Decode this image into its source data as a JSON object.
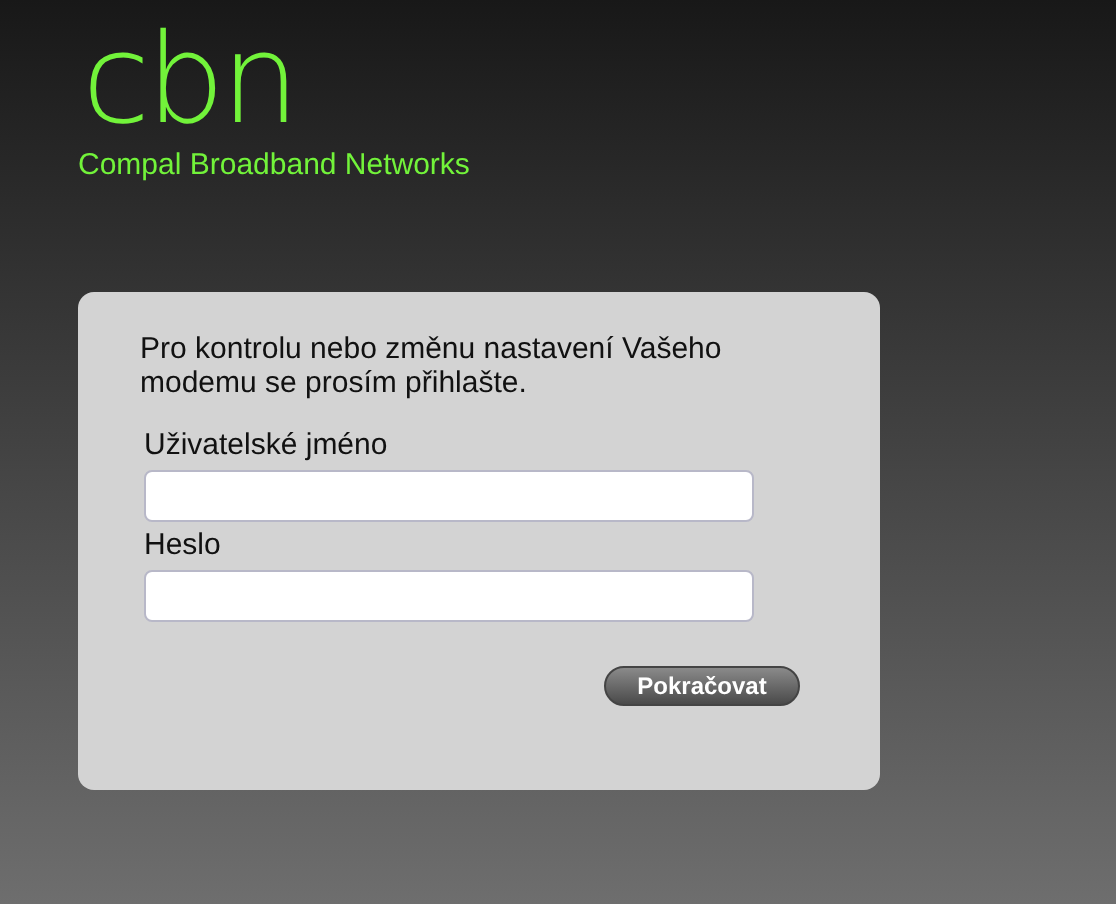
{
  "logo": "cbn",
  "tagline": "Compal Broadband Networks",
  "login": {
    "intro": "Pro kontrolu nebo změnu nastavení Vašeho modemu se prosím přihlašte.",
    "fields": [
      {
        "label": "Uživatelské jméno"
      },
      {
        "label": "Heslo"
      }
    ],
    "submit": "Pokračovat"
  }
}
